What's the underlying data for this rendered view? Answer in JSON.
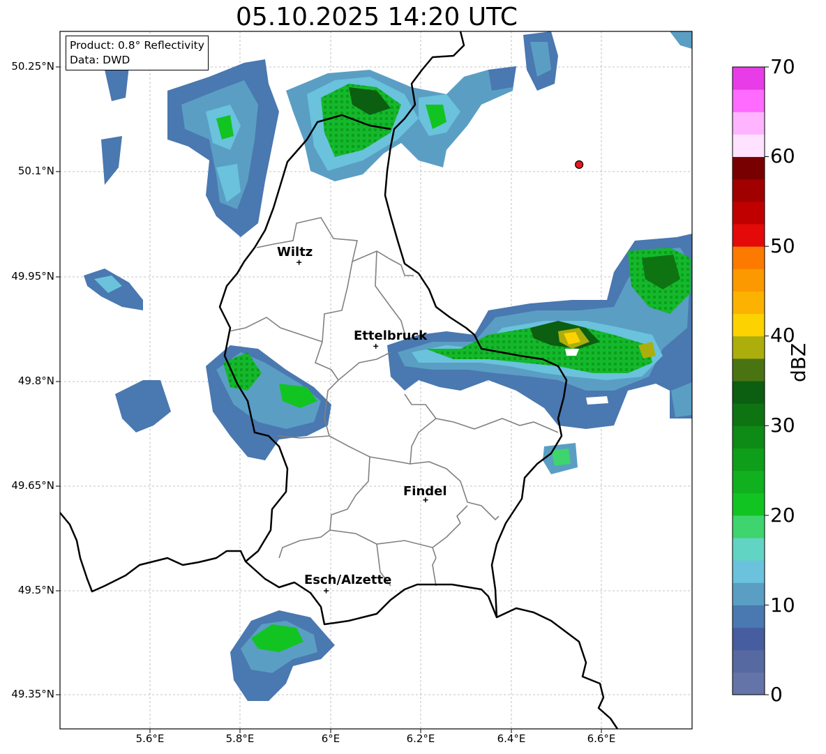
{
  "title": "05.10.2025 14:20 UTC",
  "info": {
    "product": "Product: 0.8° Reflectivity",
    "data": "Data: DWD"
  },
  "lat_ticks": [
    "50.25°N",
    "50.1°N",
    "49.95°N",
    "49.8°N",
    "49.65°N",
    "49.5°N",
    "49.35°N"
  ],
  "lon_ticks": [
    "5.6°E",
    "5.8°E",
    "6°E",
    "6.2°E",
    "6.4°E",
    "6.6°E"
  ],
  "cities": [
    {
      "name": "Wiltz",
      "lon": 5.93,
      "lat": 49.97
    },
    {
      "name": "Ettelbruck",
      "lon": 6.1,
      "lat": 49.85
    },
    {
      "name": "Findel",
      "lon": 6.21,
      "lat": 49.63
    },
    {
      "name": "Esch/Alzette",
      "lon": 5.99,
      "lat": 49.5
    }
  ],
  "radar_site_marker": {
    "lon": 6.55,
    "lat": 50.11,
    "color": "#e8191c"
  },
  "colorbar": {
    "label": "dBZ",
    "min": 0,
    "max": 70,
    "step": 2.5,
    "tick_labels": [
      "0",
      "10",
      "20",
      "30",
      "40",
      "50",
      "60",
      "70"
    ],
    "colors": [
      "#6474a8",
      "#5669a0",
      "#465ea0",
      "#4a78b0",
      "#5a9ec4",
      "#6ac2dc",
      "#62d4c4",
      "#3ed46e",
      "#12c422",
      "#10b01e",
      "#0e9e1a",
      "#0e8a16",
      "#0e7412",
      "#0c5e10",
      "#4a7412",
      "#acae0c",
      "#fcd200",
      "#fcb200",
      "#fc9800",
      "#fc7a00",
      "#e40a0a",
      "#c00000",
      "#a00000",
      "#780000",
      "#ffe2ff",
      "#ffb4ff",
      "#ff6aff",
      "#e83ce8"
    ]
  }
}
